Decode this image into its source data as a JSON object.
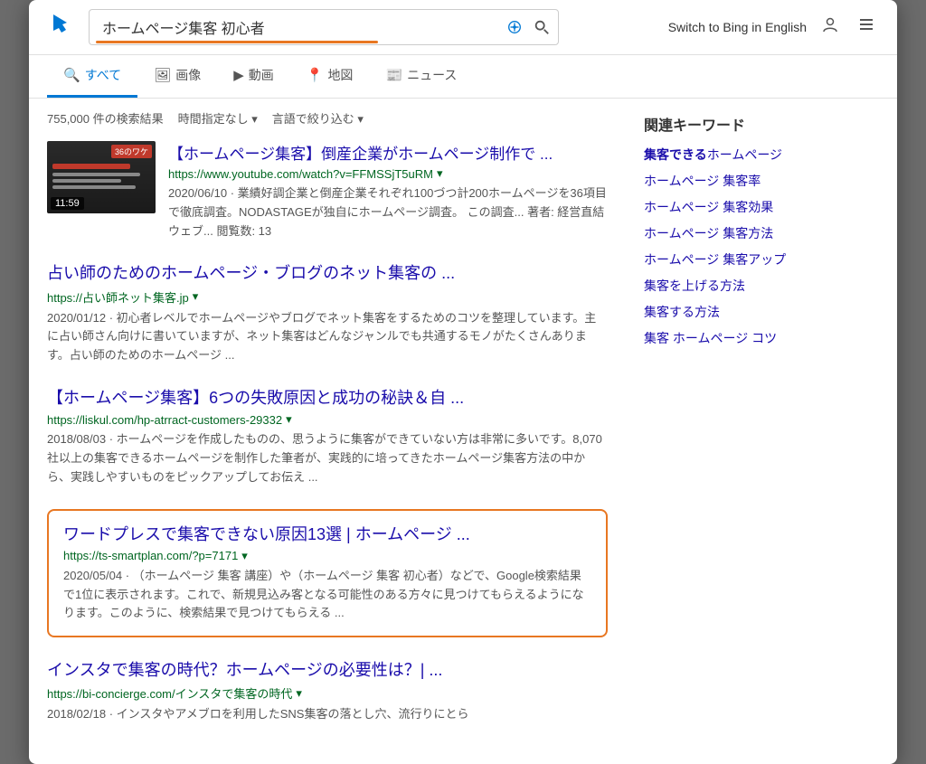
{
  "header": {
    "logo": "b",
    "search_query": "ホームページ集客 初心者",
    "switch_to_english": "Switch to Bing in English"
  },
  "nav": {
    "tabs": [
      {
        "label": "すべて",
        "icon": "🔍",
        "active": true
      },
      {
        "label": "画像",
        "icon": "🖼"
      },
      {
        "label": "動画",
        "icon": "▶"
      },
      {
        "label": "地図",
        "icon": "📍"
      },
      {
        "label": "ニュース",
        "icon": "📰"
      }
    ]
  },
  "results_meta": {
    "count": "755,000 件の検索結果",
    "filter1": "時間指定なし ▾",
    "filter2": "言語で絞り込む ▾"
  },
  "results": [
    {
      "type": "video",
      "title": "【ホームページ集客】倒産企業がホームページ制作で ...",
      "url": "https://www.youtube.com/watch?v=FFMSSjT5uRM",
      "url_arrow": "▾",
      "duration": "11:59",
      "date": "2020/06/10",
      "snippet": "業績好調企業と倒産企業それぞれ100づつ計200ホームページを36項目で徹底調査。NODASTAGEが独自にホームページ調査。 この調査... 著者: 経営直結ウェブ... 閲覧数: 13"
    },
    {
      "type": "regular",
      "title": "占い師のためのホームページ・ブログのネット集客の ...",
      "url": "https://占い師ネット集客.jp",
      "url_arrow": "▾",
      "date": "2020/01/12",
      "snippet": "初心者レベルでホームページやブログでネット集客をするためのコツを整理しています。主に占い師さん向けに書いていますが、ネット集客はどんなジャンルでも共通するモノがたくさんあります。占い師のためのホームページ ..."
    },
    {
      "type": "regular",
      "title": "【ホームページ集客】6つの失敗原因と成功の秘訣＆自 ...",
      "url": "https://liskul.com/hp-atrract-customers-29332",
      "url_arrow": "▾",
      "date": "2018/08/03",
      "snippet": "ホームページを作成したものの、思うように集客ができていない方は非常に多いです。8,070社以上の集客できるホームページを制作した筆者が、実践的に培ってきたホームページ集客方法の中から、実践しやすいものをピックアップしてお伝え ..."
    },
    {
      "type": "highlighted",
      "title": "ワードプレスで集客できない原因13選 | ホームページ ...",
      "url": "https://ts-smartplan.com/?p=7171",
      "url_arrow": "▾",
      "date": "2020/05/04",
      "snippet": "（ホームページ 集客 講座）や（ホームページ 集客 初心者）などで、Google検索結果で1位に表示されます。これで、新規見込み客となる可能性のある方々に見つけてもらえるようになります。このように、検索結果で見つけてもらえる ..."
    },
    {
      "type": "regular",
      "title": "インスタで集客の時代？ホームページの必要性は？| ...",
      "url": "https://bi-concierge.com/インスタで集客の時代",
      "url_arrow": "▾",
      "date": "2018/02/18",
      "snippet": "インスタやアメブロを利用したSNS集客の落とし穴、流行りにとら"
    }
  ],
  "sidebar": {
    "title": "関連キーワード",
    "items": [
      {
        "text": "集客できる",
        "bold_part": "集客できる",
        "suffix": "ホームページ"
      },
      {
        "text": "ホームページ 集客率"
      },
      {
        "text": "ホームページ 集客効果"
      },
      {
        "text": "ホームページ 集客方法"
      },
      {
        "text": "ホームページ 集客アップ"
      },
      {
        "text": "集客を上げる方法"
      },
      {
        "text": "集客する方法"
      },
      {
        "text": "集客 ホームページ コツ"
      }
    ]
  }
}
